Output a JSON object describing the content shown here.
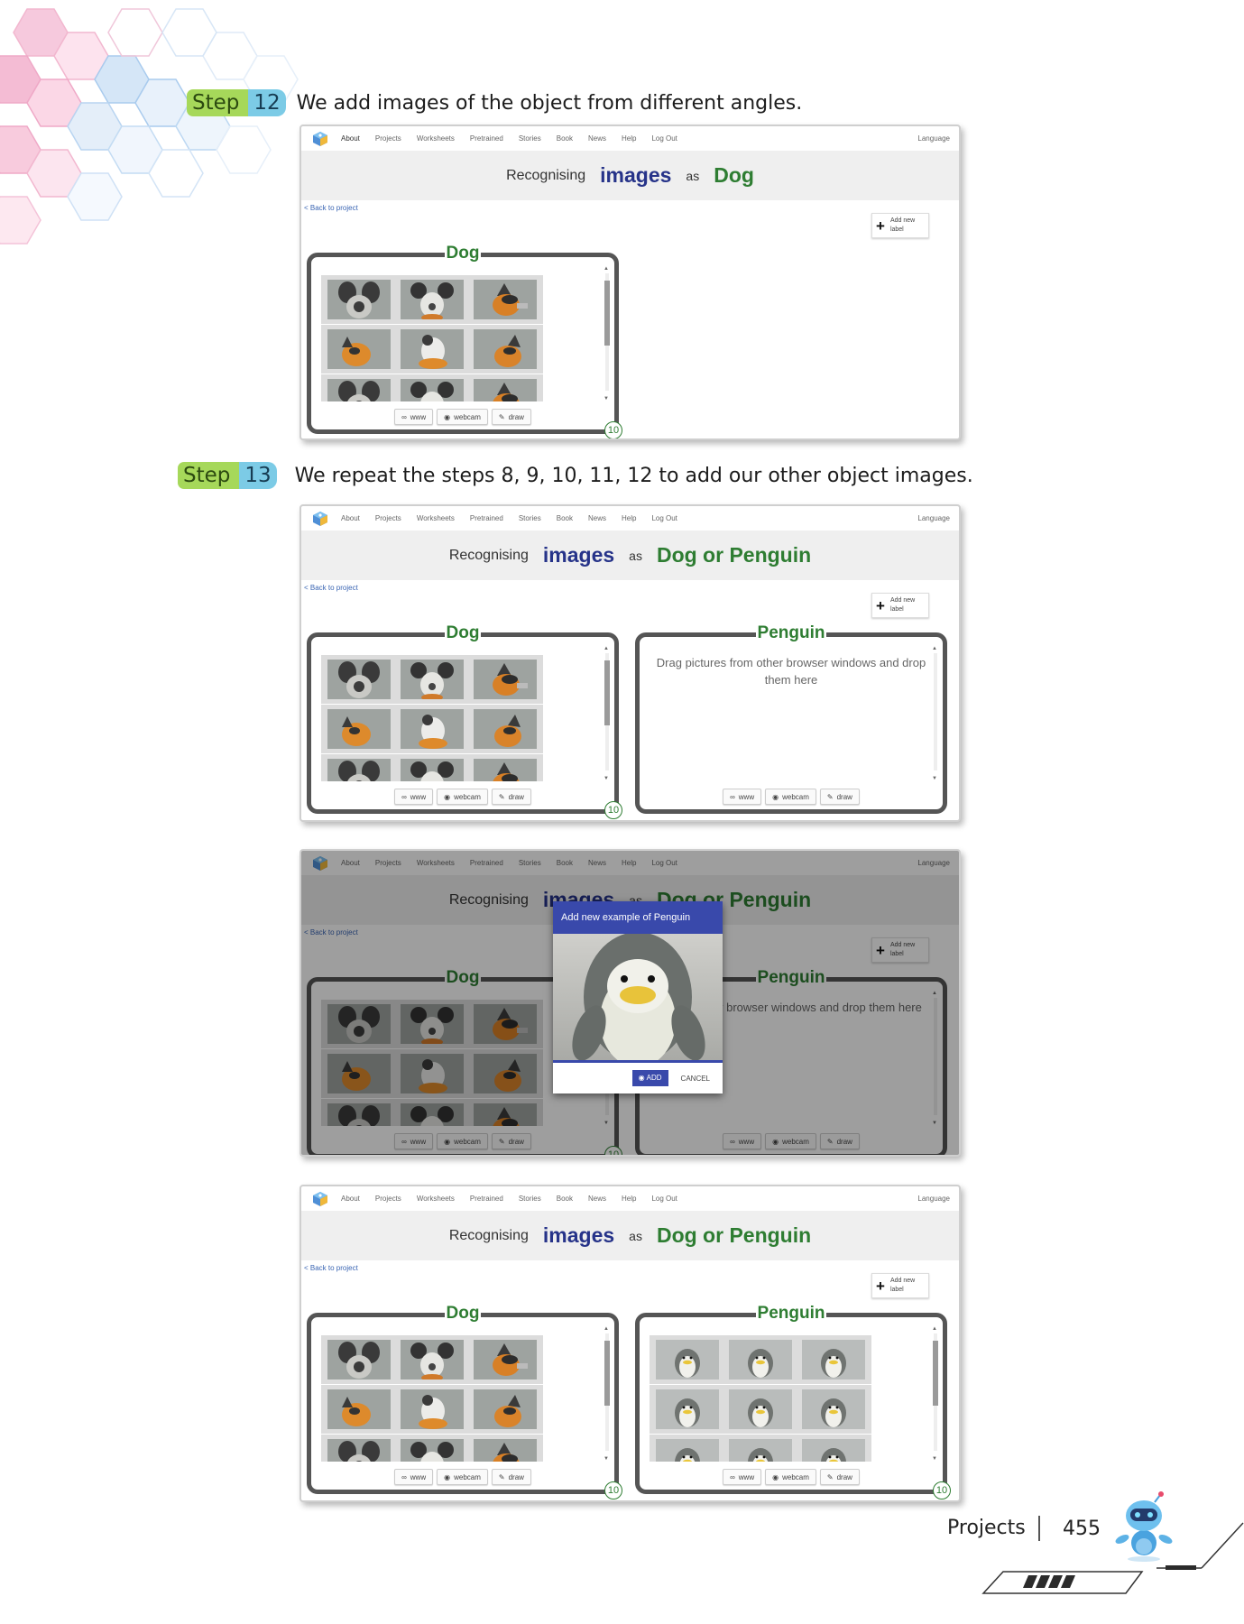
{
  "steps": [
    {
      "word": "Step",
      "number": "12",
      "text": "We add images of the object from different angles."
    },
    {
      "word": "Step",
      "number": "13",
      "text": "We repeat the steps 8, 9, 10, 11, 12 to add our other object images."
    }
  ],
  "app": {
    "nav": [
      "About",
      "Projects",
      "Worksheets",
      "Pretrained",
      "Stories",
      "Book",
      "News",
      "Help",
      "Log Out"
    ],
    "language": "Language",
    "back_link": "< Back to project",
    "add_label": "Add new label",
    "recognising": "Recognising",
    "images": "images",
    "as": "as",
    "buttons": {
      "www": "www",
      "webcam": "webcam",
      "draw": "draw"
    }
  },
  "screens": [
    {
      "target": "Dog",
      "labels": [
        {
          "name": "Dog",
          "count": "10"
        }
      ]
    },
    {
      "target": "Dog or Penguin",
      "labels": [
        {
          "name": "Dog",
          "count": "10"
        },
        {
          "name": "Penguin",
          "empty_text": "Drag pictures from other browser windows and drop them here"
        }
      ]
    },
    {
      "target": "Dog or Penguin",
      "labels": [
        {
          "name": "Dog",
          "count": "10"
        },
        {
          "name": "Penguin",
          "empty_text": "s from other browser windows and drop them here"
        }
      ],
      "modal": {
        "title": "Add new example of Penguin",
        "add": "ADD",
        "cancel": "CANCEL"
      }
    },
    {
      "target": "Dog or Penguin",
      "labels": [
        {
          "name": "Dog",
          "count": "10"
        },
        {
          "name": "Penguin",
          "count": "10"
        }
      ]
    }
  ],
  "footer": {
    "section": "Projects",
    "page": "455"
  },
  "colors": {
    "step_green": "#a6d85a",
    "step_blue": "#7ccbe6",
    "title_blue": "#263389",
    "label_green": "#2e7d32",
    "modal_blue": "#3949ab"
  },
  "icons": [
    "link-icon",
    "camera-icon",
    "pencil-icon",
    "plus-icon",
    "logo-icon",
    "robot-icon"
  ]
}
